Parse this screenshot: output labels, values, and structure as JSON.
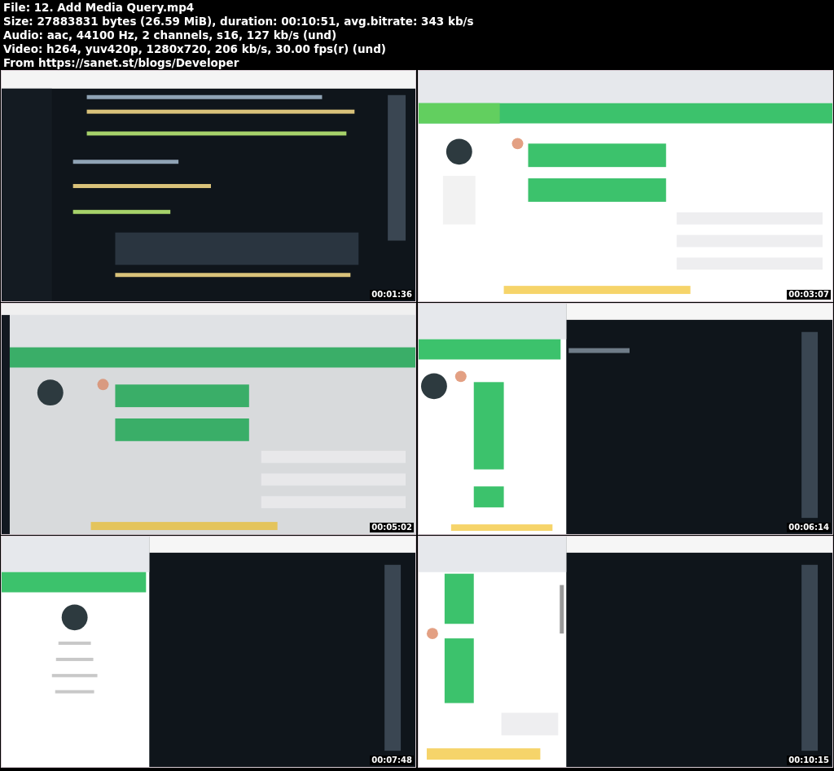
{
  "header": {
    "lines": [
      "File: 12. Add Media Query.mp4",
      "Size: 27883831 bytes (26.59 MiB), duration: 00:10:51, avg.bitrate: 343 kb/s",
      "Audio: aac, 44100 Hz, 2 channels, s16, 127 kb/s (und)",
      "Video: h264, yuv420p, 1280x720, 206 kb/s, 30.00 fps(r) (und)",
      "From https://sanet.st/blogs/Developer"
    ]
  },
  "frames": [
    {
      "kind": "picture",
      "timestamp": "00:01:36"
    },
    {
      "kind": "picture",
      "timestamp": "00:03:07"
    },
    {
      "kind": "picture",
      "timestamp": "00:05:02"
    },
    {
      "kind": "picture",
      "timestamp": "00:06:14"
    },
    {
      "kind": "picture",
      "timestamp": "00:07:48"
    },
    {
      "kind": "picture",
      "timestamp": "00:10:15"
    }
  ]
}
